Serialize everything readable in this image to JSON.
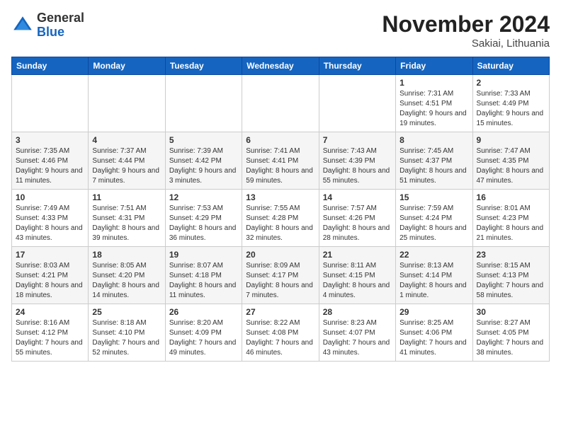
{
  "header": {
    "logo_general": "General",
    "logo_blue": "Blue",
    "month_title": "November 2024",
    "location": "Sakiai, Lithuania"
  },
  "days_of_week": [
    "Sunday",
    "Monday",
    "Tuesday",
    "Wednesday",
    "Thursday",
    "Friday",
    "Saturday"
  ],
  "weeks": [
    [
      {
        "day": "",
        "sunrise": "",
        "sunset": "",
        "daylight": ""
      },
      {
        "day": "",
        "sunrise": "",
        "sunset": "",
        "daylight": ""
      },
      {
        "day": "",
        "sunrise": "",
        "sunset": "",
        "daylight": ""
      },
      {
        "day": "",
        "sunrise": "",
        "sunset": "",
        "daylight": ""
      },
      {
        "day": "",
        "sunrise": "",
        "sunset": "",
        "daylight": ""
      },
      {
        "day": "1",
        "sunrise": "Sunrise: 7:31 AM",
        "sunset": "Sunset: 4:51 PM",
        "daylight": "Daylight: 9 hours and 19 minutes."
      },
      {
        "day": "2",
        "sunrise": "Sunrise: 7:33 AM",
        "sunset": "Sunset: 4:49 PM",
        "daylight": "Daylight: 9 hours and 15 minutes."
      }
    ],
    [
      {
        "day": "3",
        "sunrise": "Sunrise: 7:35 AM",
        "sunset": "Sunset: 4:46 PM",
        "daylight": "Daylight: 9 hours and 11 minutes."
      },
      {
        "day": "4",
        "sunrise": "Sunrise: 7:37 AM",
        "sunset": "Sunset: 4:44 PM",
        "daylight": "Daylight: 9 hours and 7 minutes."
      },
      {
        "day": "5",
        "sunrise": "Sunrise: 7:39 AM",
        "sunset": "Sunset: 4:42 PM",
        "daylight": "Daylight: 9 hours and 3 minutes."
      },
      {
        "day": "6",
        "sunrise": "Sunrise: 7:41 AM",
        "sunset": "Sunset: 4:41 PM",
        "daylight": "Daylight: 8 hours and 59 minutes."
      },
      {
        "day": "7",
        "sunrise": "Sunrise: 7:43 AM",
        "sunset": "Sunset: 4:39 PM",
        "daylight": "Daylight: 8 hours and 55 minutes."
      },
      {
        "day": "8",
        "sunrise": "Sunrise: 7:45 AM",
        "sunset": "Sunset: 4:37 PM",
        "daylight": "Daylight: 8 hours and 51 minutes."
      },
      {
        "day": "9",
        "sunrise": "Sunrise: 7:47 AM",
        "sunset": "Sunset: 4:35 PM",
        "daylight": "Daylight: 8 hours and 47 minutes."
      }
    ],
    [
      {
        "day": "10",
        "sunrise": "Sunrise: 7:49 AM",
        "sunset": "Sunset: 4:33 PM",
        "daylight": "Daylight: 8 hours and 43 minutes."
      },
      {
        "day": "11",
        "sunrise": "Sunrise: 7:51 AM",
        "sunset": "Sunset: 4:31 PM",
        "daylight": "Daylight: 8 hours and 39 minutes."
      },
      {
        "day": "12",
        "sunrise": "Sunrise: 7:53 AM",
        "sunset": "Sunset: 4:29 PM",
        "daylight": "Daylight: 8 hours and 36 minutes."
      },
      {
        "day": "13",
        "sunrise": "Sunrise: 7:55 AM",
        "sunset": "Sunset: 4:28 PM",
        "daylight": "Daylight: 8 hours and 32 minutes."
      },
      {
        "day": "14",
        "sunrise": "Sunrise: 7:57 AM",
        "sunset": "Sunset: 4:26 PM",
        "daylight": "Daylight: 8 hours and 28 minutes."
      },
      {
        "day": "15",
        "sunrise": "Sunrise: 7:59 AM",
        "sunset": "Sunset: 4:24 PM",
        "daylight": "Daylight: 8 hours and 25 minutes."
      },
      {
        "day": "16",
        "sunrise": "Sunrise: 8:01 AM",
        "sunset": "Sunset: 4:23 PM",
        "daylight": "Daylight: 8 hours and 21 minutes."
      }
    ],
    [
      {
        "day": "17",
        "sunrise": "Sunrise: 8:03 AM",
        "sunset": "Sunset: 4:21 PM",
        "daylight": "Daylight: 8 hours and 18 minutes."
      },
      {
        "day": "18",
        "sunrise": "Sunrise: 8:05 AM",
        "sunset": "Sunset: 4:20 PM",
        "daylight": "Daylight: 8 hours and 14 minutes."
      },
      {
        "day": "19",
        "sunrise": "Sunrise: 8:07 AM",
        "sunset": "Sunset: 4:18 PM",
        "daylight": "Daylight: 8 hours and 11 minutes."
      },
      {
        "day": "20",
        "sunrise": "Sunrise: 8:09 AM",
        "sunset": "Sunset: 4:17 PM",
        "daylight": "Daylight: 8 hours and 7 minutes."
      },
      {
        "day": "21",
        "sunrise": "Sunrise: 8:11 AM",
        "sunset": "Sunset: 4:15 PM",
        "daylight": "Daylight: 8 hours and 4 minutes."
      },
      {
        "day": "22",
        "sunrise": "Sunrise: 8:13 AM",
        "sunset": "Sunset: 4:14 PM",
        "daylight": "Daylight: 8 hours and 1 minute."
      },
      {
        "day": "23",
        "sunrise": "Sunrise: 8:15 AM",
        "sunset": "Sunset: 4:13 PM",
        "daylight": "Daylight: 7 hours and 58 minutes."
      }
    ],
    [
      {
        "day": "24",
        "sunrise": "Sunrise: 8:16 AM",
        "sunset": "Sunset: 4:12 PM",
        "daylight": "Daylight: 7 hours and 55 minutes."
      },
      {
        "day": "25",
        "sunrise": "Sunrise: 8:18 AM",
        "sunset": "Sunset: 4:10 PM",
        "daylight": "Daylight: 7 hours and 52 minutes."
      },
      {
        "day": "26",
        "sunrise": "Sunrise: 8:20 AM",
        "sunset": "Sunset: 4:09 PM",
        "daylight": "Daylight: 7 hours and 49 minutes."
      },
      {
        "day": "27",
        "sunrise": "Sunrise: 8:22 AM",
        "sunset": "Sunset: 4:08 PM",
        "daylight": "Daylight: 7 hours and 46 minutes."
      },
      {
        "day": "28",
        "sunrise": "Sunrise: 8:23 AM",
        "sunset": "Sunset: 4:07 PM",
        "daylight": "Daylight: 7 hours and 43 minutes."
      },
      {
        "day": "29",
        "sunrise": "Sunrise: 8:25 AM",
        "sunset": "Sunset: 4:06 PM",
        "daylight": "Daylight: 7 hours and 41 minutes."
      },
      {
        "day": "30",
        "sunrise": "Sunrise: 8:27 AM",
        "sunset": "Sunset: 4:05 PM",
        "daylight": "Daylight: 7 hours and 38 minutes."
      }
    ]
  ]
}
